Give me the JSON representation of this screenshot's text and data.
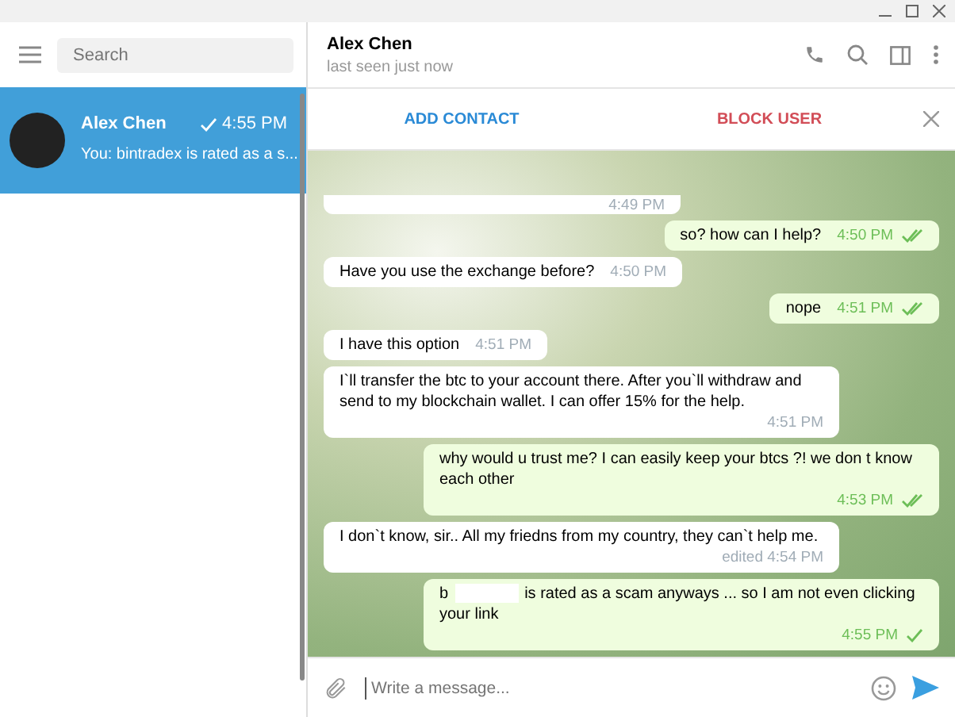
{
  "sidebar": {
    "search": {
      "placeholder": "Search"
    },
    "chats": [
      {
        "name": "Alex Chen",
        "time": "4:55 PM",
        "preview": "You: bintradex is rated as a s...",
        "read": false,
        "selected": true
      }
    ]
  },
  "chat": {
    "title": "Alex Chen",
    "status": "last seen just now",
    "actions": [
      {
        "kind": "add",
        "label": "ADD CONTACT"
      },
      {
        "kind": "block",
        "label": "BLOCK USER"
      }
    ],
    "messages": [
      {
        "outgoing": false,
        "time": "4:49 PM",
        "cut": true
      },
      {
        "outgoing": true,
        "text": "so? how can I help?",
        "time": "4:50 PM",
        "read": true
      },
      {
        "outgoing": false,
        "text": "Have you use the exchange before?",
        "time": "4:50 PM"
      },
      {
        "outgoing": true,
        "text": "nope",
        "time": "4:51 PM",
        "read": true
      },
      {
        "outgoing": false,
        "text": "I have this option",
        "time": "4:51 PM"
      },
      {
        "outgoing": false,
        "text": "I`ll transfer the btc to your account there. After you`ll withdraw and send to my blockchain wallet. I can offer 15% for the help.",
        "time": "4:51 PM",
        "wide": true
      },
      {
        "outgoing": true,
        "text": "why would u trust me? I can easily keep your btcs ?! we don t know each other",
        "time": "4:53 PM",
        "read": true,
        "wide": true
      },
      {
        "outgoing": false,
        "text": "I don`t know, sir.. All my friedns from my country, they can`t help me.",
        "time": "edited 4:54 PM",
        "wide": true
      },
      {
        "outgoing": true,
        "text": "b",
        "redacted": true,
        "text_after": "is rated as a scam anyways ... so I am not even clicking your link",
        "time": "4:55 PM",
        "read": false,
        "wide": true
      }
    ],
    "composer": {
      "placeholder": "Write a message..."
    }
  }
}
